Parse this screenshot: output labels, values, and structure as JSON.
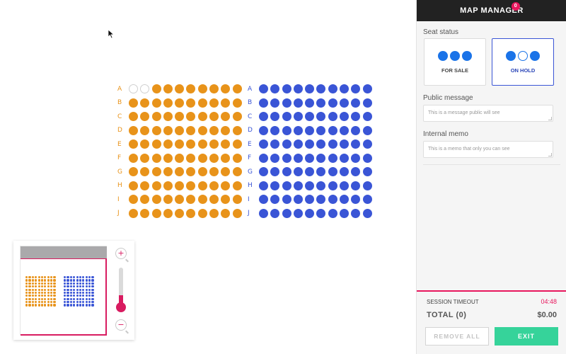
{
  "sidebar": {
    "title": "MAP MANAGER",
    "notification_count": "0",
    "seat_status_label": "Seat status",
    "status_options": [
      {
        "label": "FOR SALE",
        "selected": false,
        "dots": [
          "filled",
          "filled",
          "filled"
        ]
      },
      {
        "label": "ON HOLD",
        "selected": true,
        "dots": [
          "filled",
          "hollow",
          "filled"
        ]
      }
    ],
    "public_message": {
      "label": "Public message",
      "placeholder": "This is a message public will see"
    },
    "internal_memo": {
      "label": "Internal memo",
      "placeholder": "This is a memo that only you can see"
    }
  },
  "footer": {
    "session_timeout_label": "SESSION TIMEOUT",
    "session_timeout_value": "04:48",
    "total_label": "TOTAL (0)",
    "total_value": "$0.00",
    "remove_all_label": "REMOVE ALL",
    "exit_label": "EXIT"
  },
  "seat_map": {
    "rows": [
      "A",
      "B",
      "C",
      "D",
      "E",
      "F",
      "G",
      "H",
      "I",
      "J"
    ],
    "seats_per_row": 10,
    "left_section": {
      "color": "#e8931a",
      "empty_seats": [
        {
          "row": "A",
          "seat": 1
        },
        {
          "row": "A",
          "seat": 2
        }
      ]
    },
    "right_section": {
      "color": "#3a55d6",
      "empty_seats": []
    }
  },
  "minimap": {
    "zoom_level": 0.35
  },
  "colors": {
    "accent": "#e8175d",
    "primary": "#3a55d6",
    "orange": "#e8931a",
    "exit": "#36d39a",
    "header": "#222222"
  },
  "icons": {
    "cursor": "cursor-arrow-icon",
    "zoom_in": "zoom-in-icon",
    "zoom_out": "zoom-out-icon"
  }
}
